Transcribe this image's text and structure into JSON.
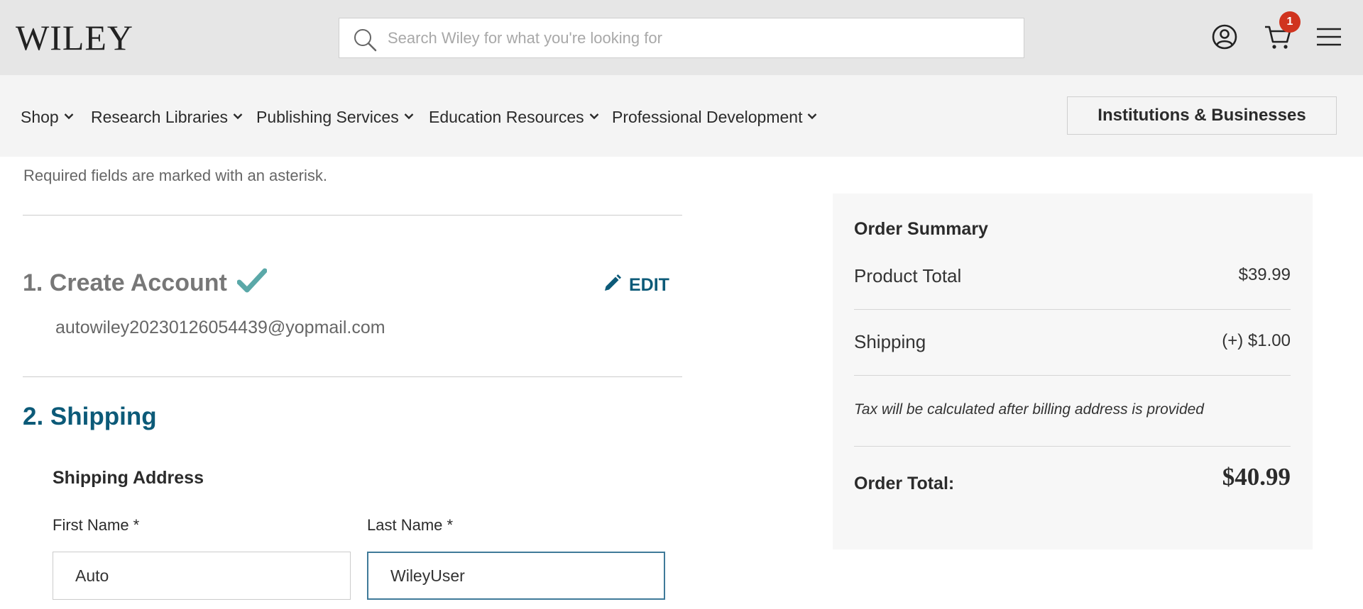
{
  "header": {
    "logo": "WILEY",
    "search": {
      "placeholder": "Search Wiley for what you're looking for",
      "value": ""
    },
    "cart_count": "1",
    "icons": [
      "search-icon",
      "account-icon",
      "cart-icon",
      "menu-icon"
    ]
  },
  "nav": {
    "items": [
      {
        "label": "Shop"
      },
      {
        "label": "Research Libraries"
      },
      {
        "label": "Publishing Services"
      },
      {
        "label": "Education Resources"
      },
      {
        "label": "Professional Development"
      }
    ],
    "institutions_button": "Institutions & Businesses"
  },
  "checkout": {
    "required_note": "Required fields are marked with an asterisk.",
    "step1": {
      "title": "1. Create Account",
      "edit_label": "EDIT",
      "email": "autowiley20230126054439@yopmail.com"
    },
    "step2": {
      "title": "2. Shipping",
      "section_title": "Shipping Address",
      "first_name_label": "First Name *",
      "first_name_value": "Auto",
      "last_name_label": "Last Name *",
      "last_name_value": "WileyUser"
    }
  },
  "summary": {
    "title": "Order Summary",
    "product_total_label": "Product Total",
    "product_total_value": "$39.99",
    "shipping_label": "Shipping",
    "shipping_value": "(+) $1.00",
    "tax_note": "Tax will be calculated after billing address is provided",
    "order_total_label": "Order Total:",
    "order_total_value": "$40.99"
  },
  "colors": {
    "header_bg": "#e6e6e6",
    "nav_bg": "#f4f4f4",
    "accent": "#0c5a78",
    "check": "#5aa8a8",
    "badge": "#d0341f"
  }
}
